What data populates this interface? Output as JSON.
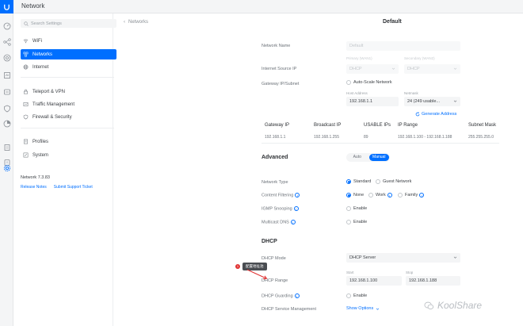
{
  "header": {
    "title": "Network"
  },
  "search": {
    "placeholder": "Search Settings"
  },
  "sidebar": {
    "items": [
      {
        "label": "WiFi"
      },
      {
        "label": "Networks"
      },
      {
        "label": "Internet"
      },
      {
        "label": "Teleport & VPN"
      },
      {
        "label": "Traffic Management"
      },
      {
        "label": "Firewall & Security"
      },
      {
        "label": "Profiles"
      },
      {
        "label": "System"
      }
    ],
    "version": "Network 7.3.83",
    "release_notes": "Release Notes",
    "support": "Submit Support Ticket"
  },
  "main": {
    "back_label": "Networks",
    "title": "Default",
    "network_name": {
      "label": "Network Name",
      "value": "Default"
    },
    "internet_source": {
      "label": "Internet Source IP",
      "primary_label": "Primary (WAN1)",
      "secondary_label": "Secondary (WAN2)",
      "primary_value": "DHCP",
      "secondary_value": "DHCP"
    },
    "gateway": {
      "label": "Gateway IP/Subnet",
      "auto_scale": "Auto-Scale Network",
      "host_label": "Host Address",
      "netmask_label": "Netmask",
      "host_value": "192.168.1.1",
      "netmask_value": "24 (249 usable..."
    },
    "generate": "Generate Address",
    "table": {
      "headers": [
        "Gateway IP",
        "Broadcast IP",
        "USABLE IPs",
        "IP Range",
        "Subnet Mask"
      ],
      "row": [
        "192.168.1.1",
        "192.168.1.255",
        "89",
        "192.168.1.100 - 192.168.1.188",
        "255.255.255.0"
      ]
    },
    "advanced": {
      "title": "Advanced",
      "auto": "Auto",
      "manual": "Manual"
    },
    "network_type": {
      "label": "Network Type",
      "opt1": "Standard",
      "opt2": "Guest Network"
    },
    "content_filtering": {
      "label": "Content Filtering",
      "opt1": "None",
      "opt2": "Work",
      "opt3": "Family"
    },
    "igmp": {
      "label": "IGMP Snooping",
      "value": "Enable"
    },
    "mdns": {
      "label": "Multicast DNS",
      "value": "Enable"
    },
    "dhcp": {
      "title": "DHCP",
      "mode_label": "DHCP Mode",
      "mode_value": "DHCP Server",
      "range_label": "DHCP Range",
      "start_label": "Start",
      "stop_label": "Stop",
      "start_value": "192.168.1.100",
      "stop_value": "192.168.1.188",
      "guarding_label": "DHCP Guarding",
      "guarding_value": "Enable",
      "service_label": "DHCP Service Management",
      "show_options": "Show Options"
    },
    "callout": {
      "number": "1",
      "text": "配置地址池"
    }
  },
  "watermark": "KoolShare",
  "colors": {
    "accent": "#006fff",
    "callout": "#e03131"
  }
}
